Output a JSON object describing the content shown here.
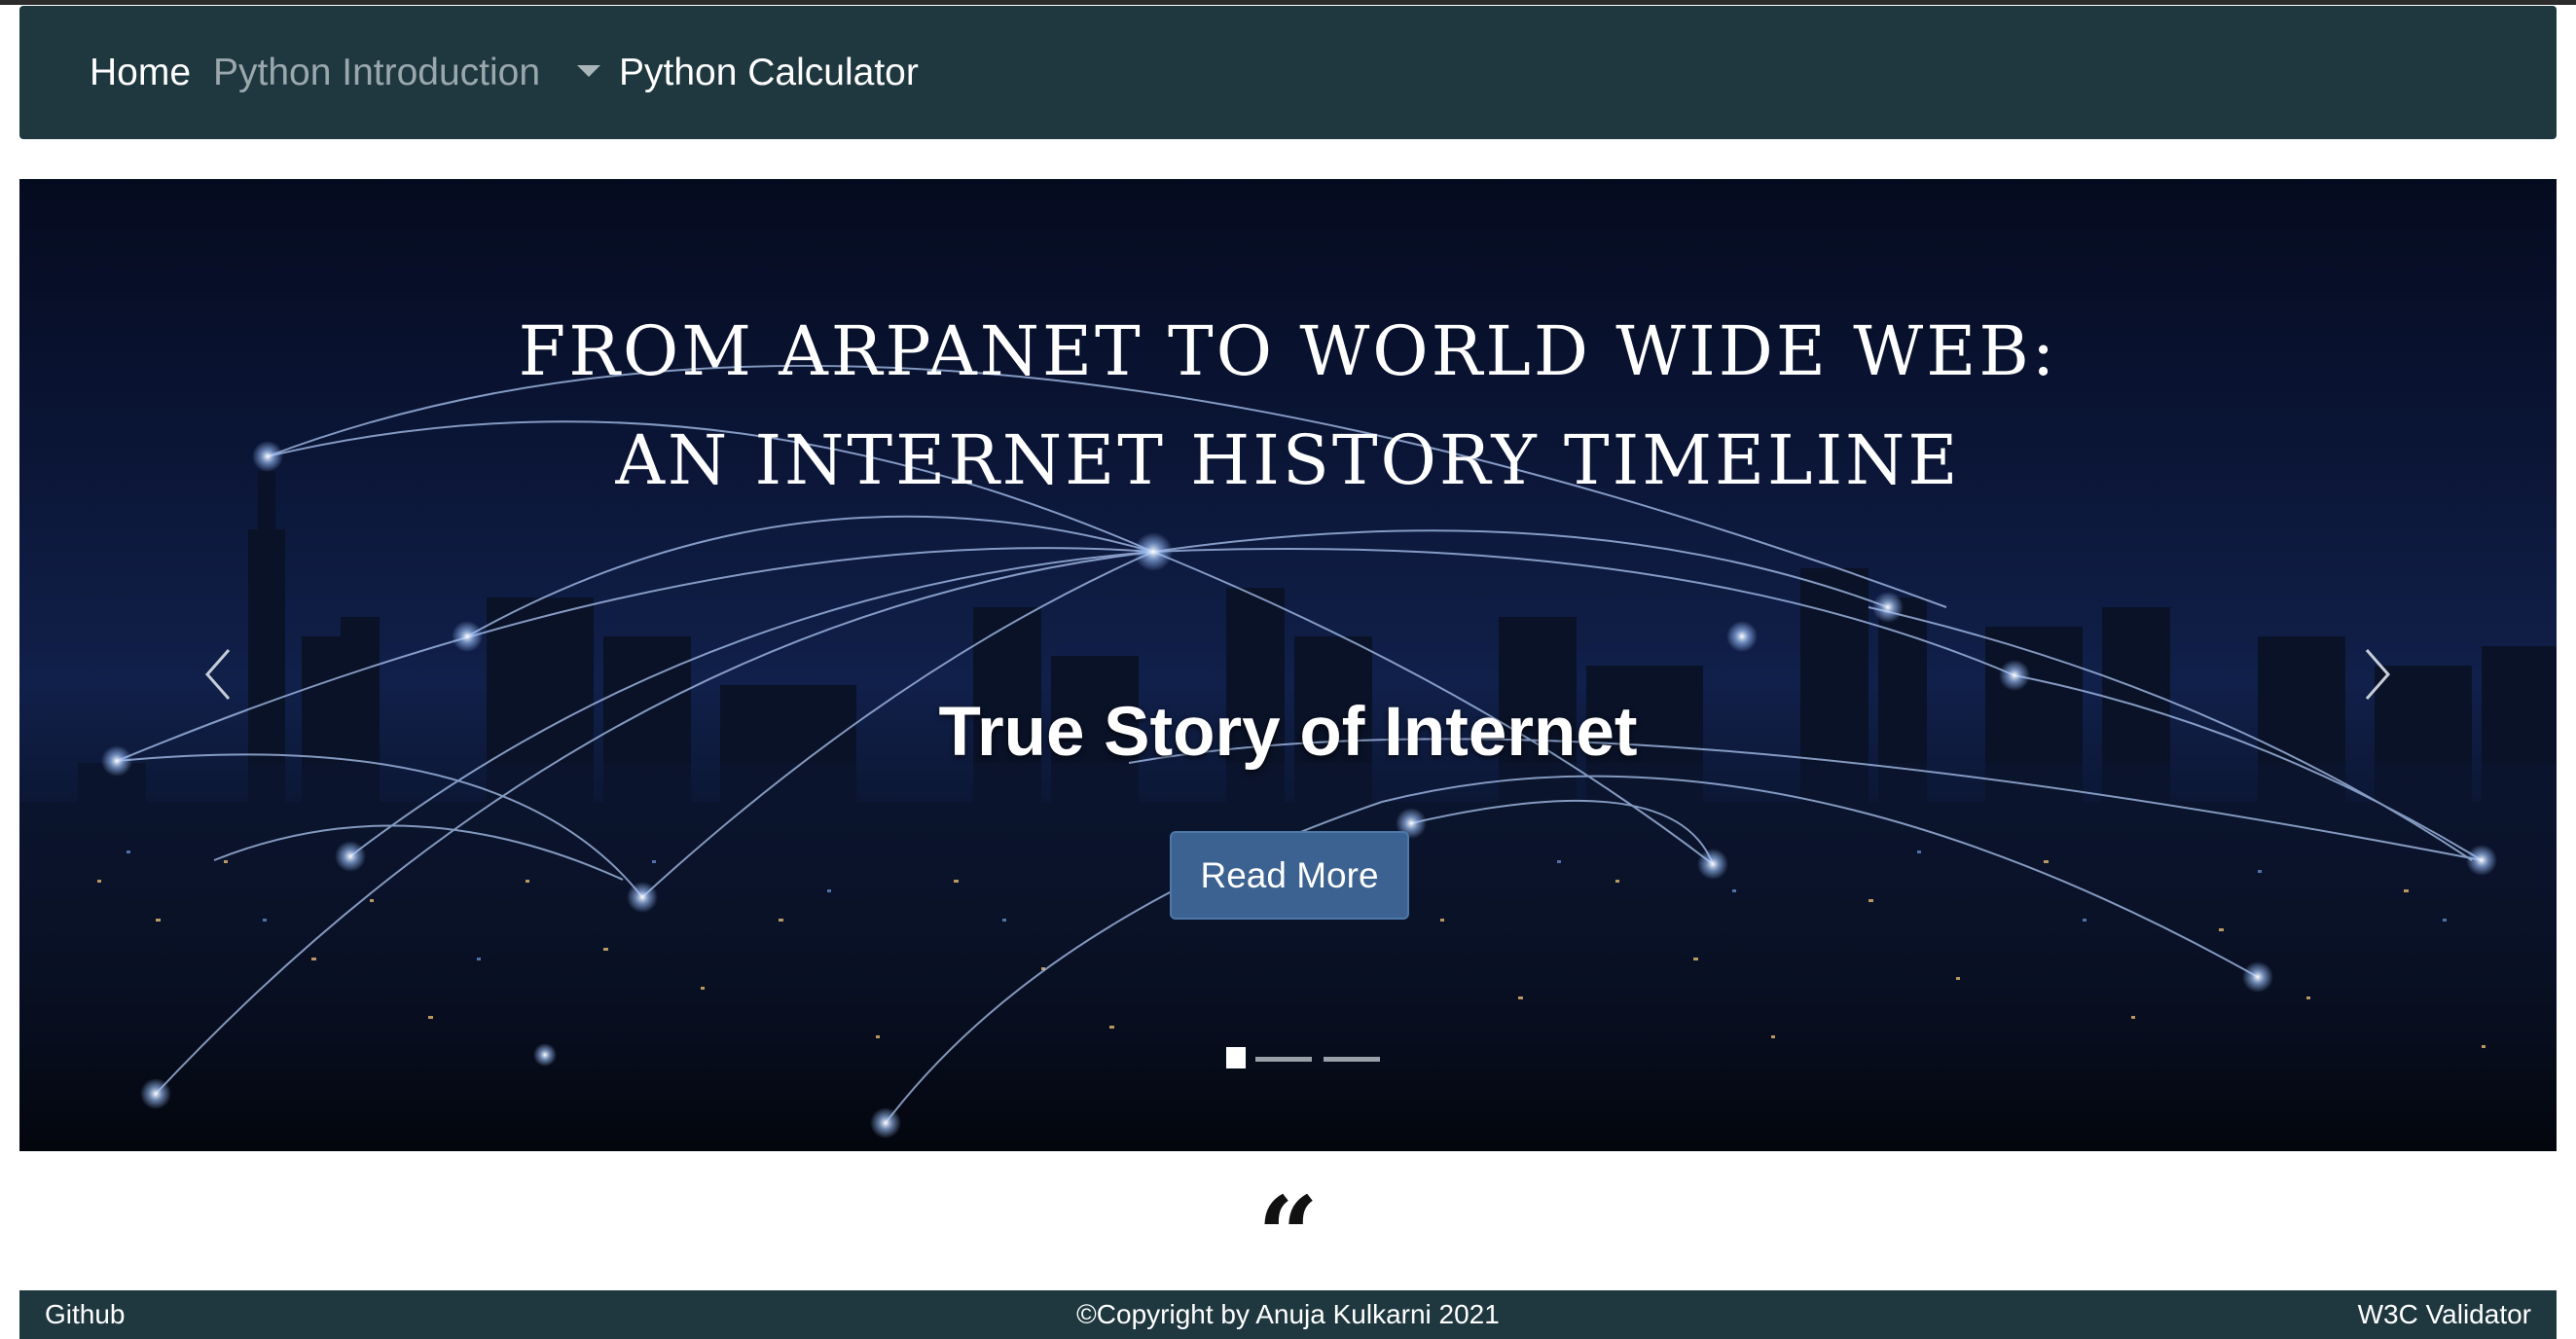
{
  "nav": {
    "home": "Home",
    "python_intro": "Python Introduction",
    "python_calculator": "Python Calculator"
  },
  "carousel": {
    "title_line1": "FROM ARPANET TO WORLD WIDE WEB:",
    "title_line2": "AN INTERNET HISTORY TIMELINE",
    "caption": "True Story of Internet",
    "button": "Read More",
    "slides": 3,
    "active_slide": 1
  },
  "quote_mark": "“",
  "footer": {
    "github": "Github",
    "copyright": "©Copyright by Anuja Kulkarni 2021",
    "validator": "W3C Validator"
  },
  "colors": {
    "navbar": "#1f3840",
    "button": "#3b6290",
    "hero_sky": "#0b1638"
  },
  "icons": [
    "chevron-left-icon",
    "chevron-right-icon",
    "caret-down-icon",
    "quote-icon"
  ]
}
